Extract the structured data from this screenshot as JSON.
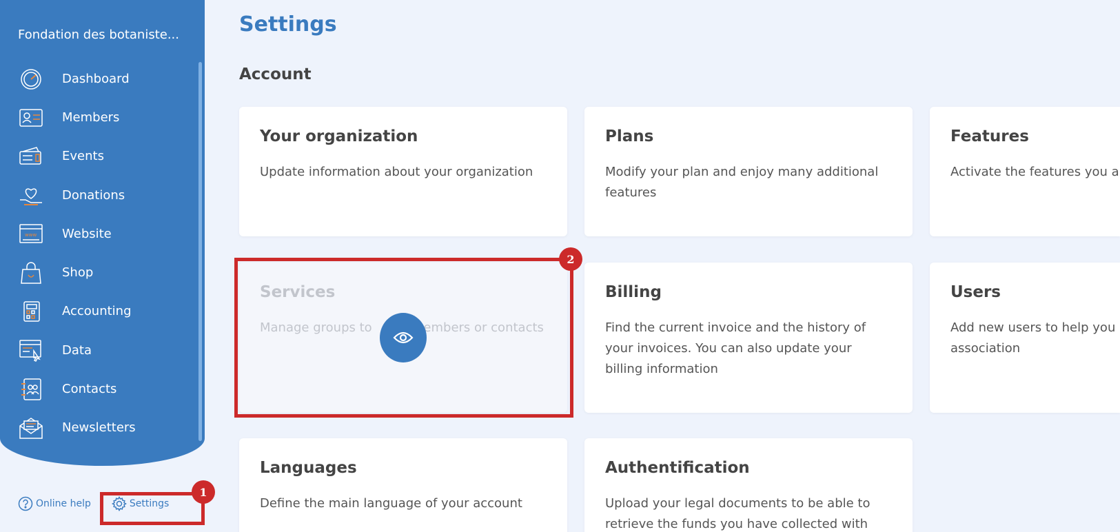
{
  "sidebar": {
    "org_name": "Fondation des botaniste...",
    "items": [
      {
        "label": "Dashboard",
        "icon": "dashboard-gauge-icon"
      },
      {
        "label": "Members",
        "icon": "member-card-icon"
      },
      {
        "label": "Events",
        "icon": "ticket-icon"
      },
      {
        "label": "Donations",
        "icon": "heart-hand-icon"
      },
      {
        "label": "Website",
        "icon": "browser-www-icon"
      },
      {
        "label": "Shop",
        "icon": "shopping-bag-icon"
      },
      {
        "label": "Accounting",
        "icon": "calculator-icon"
      },
      {
        "label": "Data",
        "icon": "data-window-cursor-icon"
      },
      {
        "label": "Contacts",
        "icon": "contacts-book-icon"
      },
      {
        "label": "Newsletters",
        "icon": "envelope-icon"
      }
    ],
    "help_label": "Online help",
    "settings_label": "Settings"
  },
  "main": {
    "title": "Settings",
    "section": "Account",
    "cards": [
      {
        "title": "Your organization",
        "desc": "Update information about your organization"
      },
      {
        "title": "Plans",
        "desc": "Modify your plan and enjoy many additional features"
      },
      {
        "title": "Features",
        "desc": "Activate the features you a"
      },
      {
        "title": "Services",
        "desc": "Manage groups to          members or contacts"
      },
      {
        "title": "Billing",
        "desc": "Find the current invoice and the history of your invoices. You can also update your billing information"
      },
      {
        "title": "Users",
        "desc": "Add new users to help you association"
      },
      {
        "title": "Languages",
        "desc": "Define the main language of your account"
      },
      {
        "title": "Authentification",
        "desc": "Upload your legal documents to be able to retrieve the funds you have collected with"
      }
    ]
  },
  "annotations": {
    "badge_1": "1",
    "badge_2": "2"
  },
  "colors": {
    "primary": "#3a7bbf",
    "background": "#eef3fc",
    "highlight": "#cc2a2a",
    "icon_accent": "#e8873a"
  }
}
